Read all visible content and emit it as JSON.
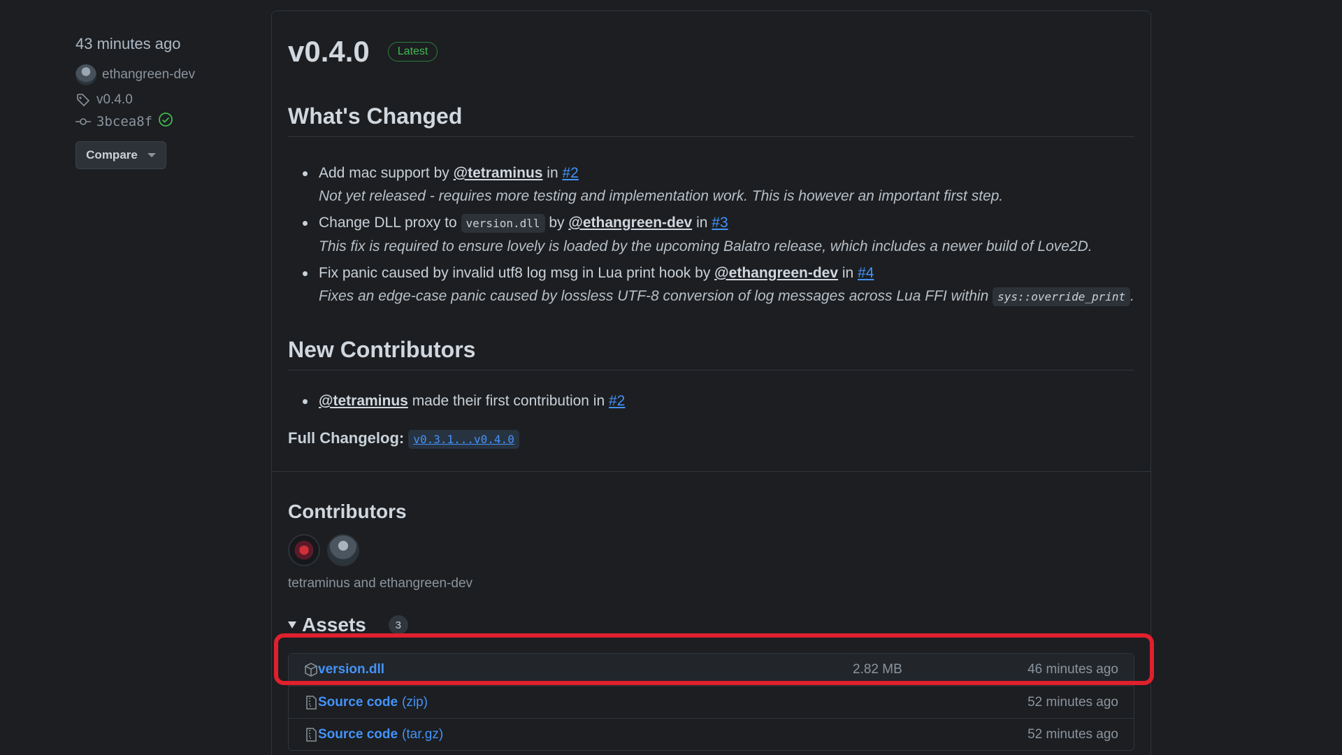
{
  "sidebar": {
    "time_ago": "43 minutes ago",
    "author": "ethangreen-dev",
    "tag": "v0.4.0",
    "commit": "3bcea8f",
    "compare_label": "Compare"
  },
  "release": {
    "title": "v0.4.0",
    "badge": "Latest"
  },
  "whats_changed": {
    "heading": "What's Changed",
    "items": [
      {
        "text1": "Add mac support by",
        "user": "@tetraminus",
        "in": "in",
        "pr": "#2",
        "note": "Not yet released - requires more testing and implementation work. This is however an important first step."
      },
      {
        "text1": "Change DLL proxy to",
        "code": "version.dll",
        "by": "by",
        "user": "@ethangreen-dev",
        "in": "in",
        "pr": "#3",
        "note": "This fix is required to ensure lovely is loaded by the upcoming Balatro release, which includes a newer build of Love2D."
      },
      {
        "text1": "Fix panic caused by invalid utf8 log msg in Lua print hook by",
        "user": "@ethangreen-dev",
        "in": "in",
        "pr": "#4",
        "note": "Fixes an edge-case panic caused by lossless UTF-8 conversion of log messages across Lua FFI within",
        "note_code": "sys::override_print",
        "note_end": "."
      }
    ]
  },
  "new_contributors": {
    "heading": "New Contributors",
    "user": "@tetraminus",
    "text": "made their first contribution in",
    "pr": "#2"
  },
  "full_changelog": {
    "label": "Full Changelog:",
    "range": "v0.3.1...v0.4.0"
  },
  "contributors": {
    "heading": "Contributors",
    "names": "tetraminus and ethangreen-dev"
  },
  "assets": {
    "heading": "Assets",
    "count": "3",
    "items": [
      {
        "name": "version.dll",
        "ext": "",
        "size": "2.82 MB",
        "time": "46 minutes ago",
        "icon": "package-icon"
      },
      {
        "name": "Source code",
        "ext": "(zip)",
        "size": "",
        "time": "52 minutes ago",
        "icon": "file-zip-icon"
      },
      {
        "name": "Source code",
        "ext": "(tar.gz)",
        "size": "",
        "time": "52 minutes ago",
        "icon": "file-zip-icon"
      }
    ]
  },
  "colors": {
    "background": "#1c1e21",
    "link": "#4493f8",
    "latest_badge": "#3fb950",
    "highlight": "#e0202d"
  }
}
